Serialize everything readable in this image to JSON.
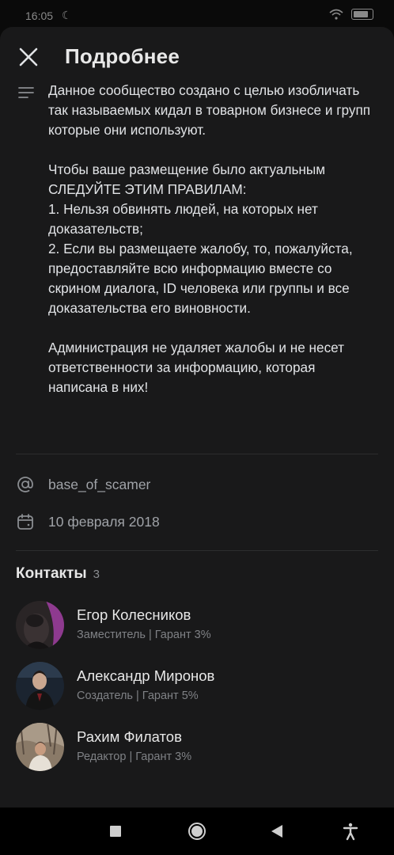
{
  "status_bar": {
    "time": "16:05",
    "battery_icon": "battery-icon",
    "wifi_icon": "wifi-icon"
  },
  "header": {
    "title": "Подробнее",
    "close_icon": "close-icon"
  },
  "description": {
    "icon": "text-lines-icon",
    "text": "Данное сообщество создано с целью изобличать так называемых кидал в товарном бизнесе и групп которые они используют.\n\nЧтобы ваше размещение было актуальным СЛЕДУЙТЕ ЭТИМ ПРАВИЛАМ:\n1. Нельзя обвинять людей, на которых нет доказательств;\n2. Если вы размещаете жалобу, то, пожалуйста, предоставляйте всю информацию вместе со скрином диалога, ID человека или группы и все доказательства его виновности.\n\nАдминистрация не удаляет жалобы и не несет ответственности за информацию, которая написана в них!"
  },
  "info": {
    "address": "base_of_scamer",
    "address_icon": "at-icon",
    "date": "10 февраля 2018",
    "date_icon": "calendar-icon"
  },
  "contacts": {
    "title": "Контакты",
    "count": "3",
    "items": [
      {
        "name": "Егор Колесников",
        "role": "Заместитель | Гарант 3%"
      },
      {
        "name": "Александр Миронов",
        "role": "Создатель | Гарант 5%"
      },
      {
        "name": "Рахим Филатов",
        "role": "Редактор | Гарант 3%"
      }
    ]
  },
  "nav_bar": {
    "items": [
      "square-icon",
      "home-circle-icon",
      "back-triangle-icon",
      "accessibility-icon"
    ]
  },
  "colors": {
    "sheet_bg": "#19191a",
    "text_primary": "#e1e3e6",
    "text_secondary": "#7f8185",
    "divider": "#2c2d2e"
  }
}
